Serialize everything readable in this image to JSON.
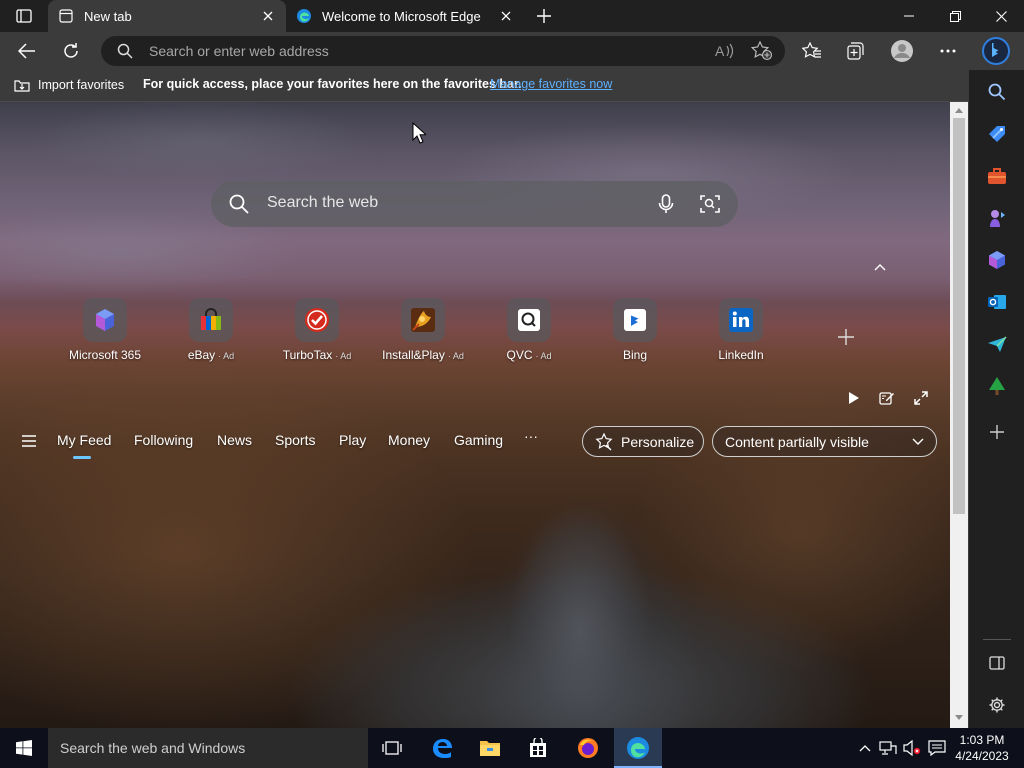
{
  "browser": {
    "tabs": [
      {
        "title": "New tab",
        "active": true
      },
      {
        "title": "Welcome to Microsoft Edge",
        "active": false
      }
    ],
    "address_bar": {
      "placeholder": "Search or enter web address"
    }
  },
  "favorites_bar": {
    "import_label": "Import favorites",
    "hint": "For quick access, place your favorites here on the favorites bar.",
    "manage_link": "Manage favorites now"
  },
  "newtab": {
    "search_placeholder": "Search the web",
    "quick_links": [
      {
        "label": "Microsoft 365",
        "ad": ""
      },
      {
        "label": "eBay",
        "ad": "Ad"
      },
      {
        "label": "TurboTax",
        "ad": "Ad"
      },
      {
        "label": "Install&Play",
        "ad": "Ad"
      },
      {
        "label": "QVC",
        "ad": "Ad"
      },
      {
        "label": "Bing",
        "ad": ""
      },
      {
        "label": "LinkedIn",
        "ad": ""
      }
    ],
    "feed_nav": {
      "items": [
        "My Feed",
        "Following",
        "News",
        "Sports",
        "Play",
        "Money",
        "Gaming"
      ],
      "active": "My Feed",
      "more": "···",
      "personalize": "Personalize",
      "visibility": "Content partially visible"
    }
  },
  "sidebar": {
    "icons": [
      "search-icon",
      "shopping-tag-icon",
      "tools-icon",
      "games-icon",
      "microsoft-365-icon",
      "outlook-icon",
      "drop-icon",
      "tree-icon",
      "add-icon",
      "hide-sidebar-icon",
      "settings-icon"
    ]
  },
  "taskbar": {
    "search_placeholder": "Search the web and Windows",
    "apps": [
      "task-view-icon",
      "edge-legacy-icon",
      "file-explorer-icon",
      "store-icon",
      "firefox-icon",
      "edge-icon"
    ],
    "clock": {
      "time": "1:03 PM",
      "date": "4/24/2023"
    }
  },
  "colors": {
    "tab_active": "#3b3b3b",
    "chrome_dark": "#202020",
    "link": "#5eb0ff",
    "feed_active_underline": "#6cc6ff",
    "taskbar": "#0d0f1a"
  }
}
